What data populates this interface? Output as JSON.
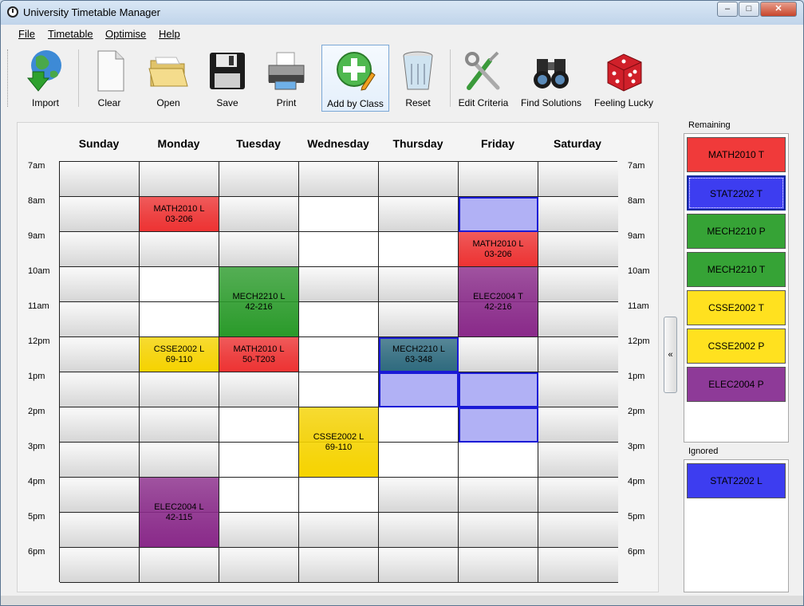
{
  "window": {
    "title": "University Timetable Manager",
    "min": "–",
    "max": "□",
    "close": "✕"
  },
  "menu": {
    "file": "File",
    "timetable": "Timetable",
    "optimise": "Optimise",
    "help": "Help"
  },
  "toolbar": {
    "import": "Import",
    "clear": "Clear",
    "open": "Open",
    "save": "Save",
    "print": "Print",
    "add_by_class": "Add by Class",
    "reset": "Reset",
    "edit_criteria": "Edit Criteria",
    "find_solutions": "Find Solutions",
    "feeling_lucky": "Feeling Lucky"
  },
  "days": [
    "Sunday",
    "Monday",
    "Tuesday",
    "Wednesday",
    "Thursday",
    "Friday",
    "Saturday"
  ],
  "times": [
    "7am",
    "8am",
    "9am",
    "10am",
    "11am",
    "12pm",
    "1pm",
    "2pm",
    "3pm",
    "4pm",
    "5pm",
    "6pm"
  ],
  "classes": [
    {
      "code": "MATH2010 L",
      "room": "03-206",
      "day": "Monday",
      "start": "8am",
      "hours": 1,
      "color": "#ee3333"
    },
    {
      "code": "CSSE2002 L",
      "room": "69-110",
      "day": "Monday",
      "start": "12pm",
      "hours": 1,
      "color": "#f7d400"
    },
    {
      "code": "ELEC2004 L",
      "room": "42-115",
      "day": "Monday",
      "start": "4pm",
      "hours": 2,
      "color": "#8a2a8a"
    },
    {
      "code": "MECH2210 L",
      "room": "42-216",
      "day": "Tuesday",
      "start": "10am",
      "hours": 2,
      "color": "#2a9a2a"
    },
    {
      "code": "MATH2010 L",
      "room": "50-T203",
      "day": "Tuesday",
      "start": "12pm",
      "hours": 1,
      "color": "#ee3333"
    },
    {
      "code": "CSSE2002 L",
      "room": "69-110",
      "day": "Wednesday",
      "start": "2pm",
      "hours": 2,
      "color": "#f7d400"
    },
    {
      "code": "MECH2210 L",
      "room": "63-348",
      "day": "Thursday",
      "start": "12pm",
      "hours": 1,
      "color": "#2f6b7f"
    },
    {
      "code": "MATH2010 L",
      "room": "03-206",
      "day": "Friday",
      "start": "9am",
      "hours": 1,
      "color": "#ee3333"
    },
    {
      "code": "ELEC2004 T",
      "room": "42-216",
      "day": "Friday",
      "start": "10am",
      "hours": 2,
      "color": "#8a2a8a"
    }
  ],
  "remaining_label": "Remaining",
  "remaining": [
    {
      "label": "MATH2010 T",
      "color": "#f03a3a"
    },
    {
      "label": "STAT2202 T",
      "color": "#3d3df0"
    },
    {
      "label": "MECH2210 P",
      "color": "#36a336"
    },
    {
      "label": "MECH2210 T",
      "color": "#36a336"
    },
    {
      "label": "CSSE2002 T",
      "color": "#ffe11f"
    },
    {
      "label": "CSSE2002 P",
      "color": "#ffe11f"
    },
    {
      "label": "ELEC2004 P",
      "color": "#8e3a98"
    }
  ],
  "ignored_label": "Ignored",
  "ignored": [
    {
      "label": "STAT2202 L",
      "color": "#3d3df0"
    }
  ],
  "collapse_label": "«"
}
